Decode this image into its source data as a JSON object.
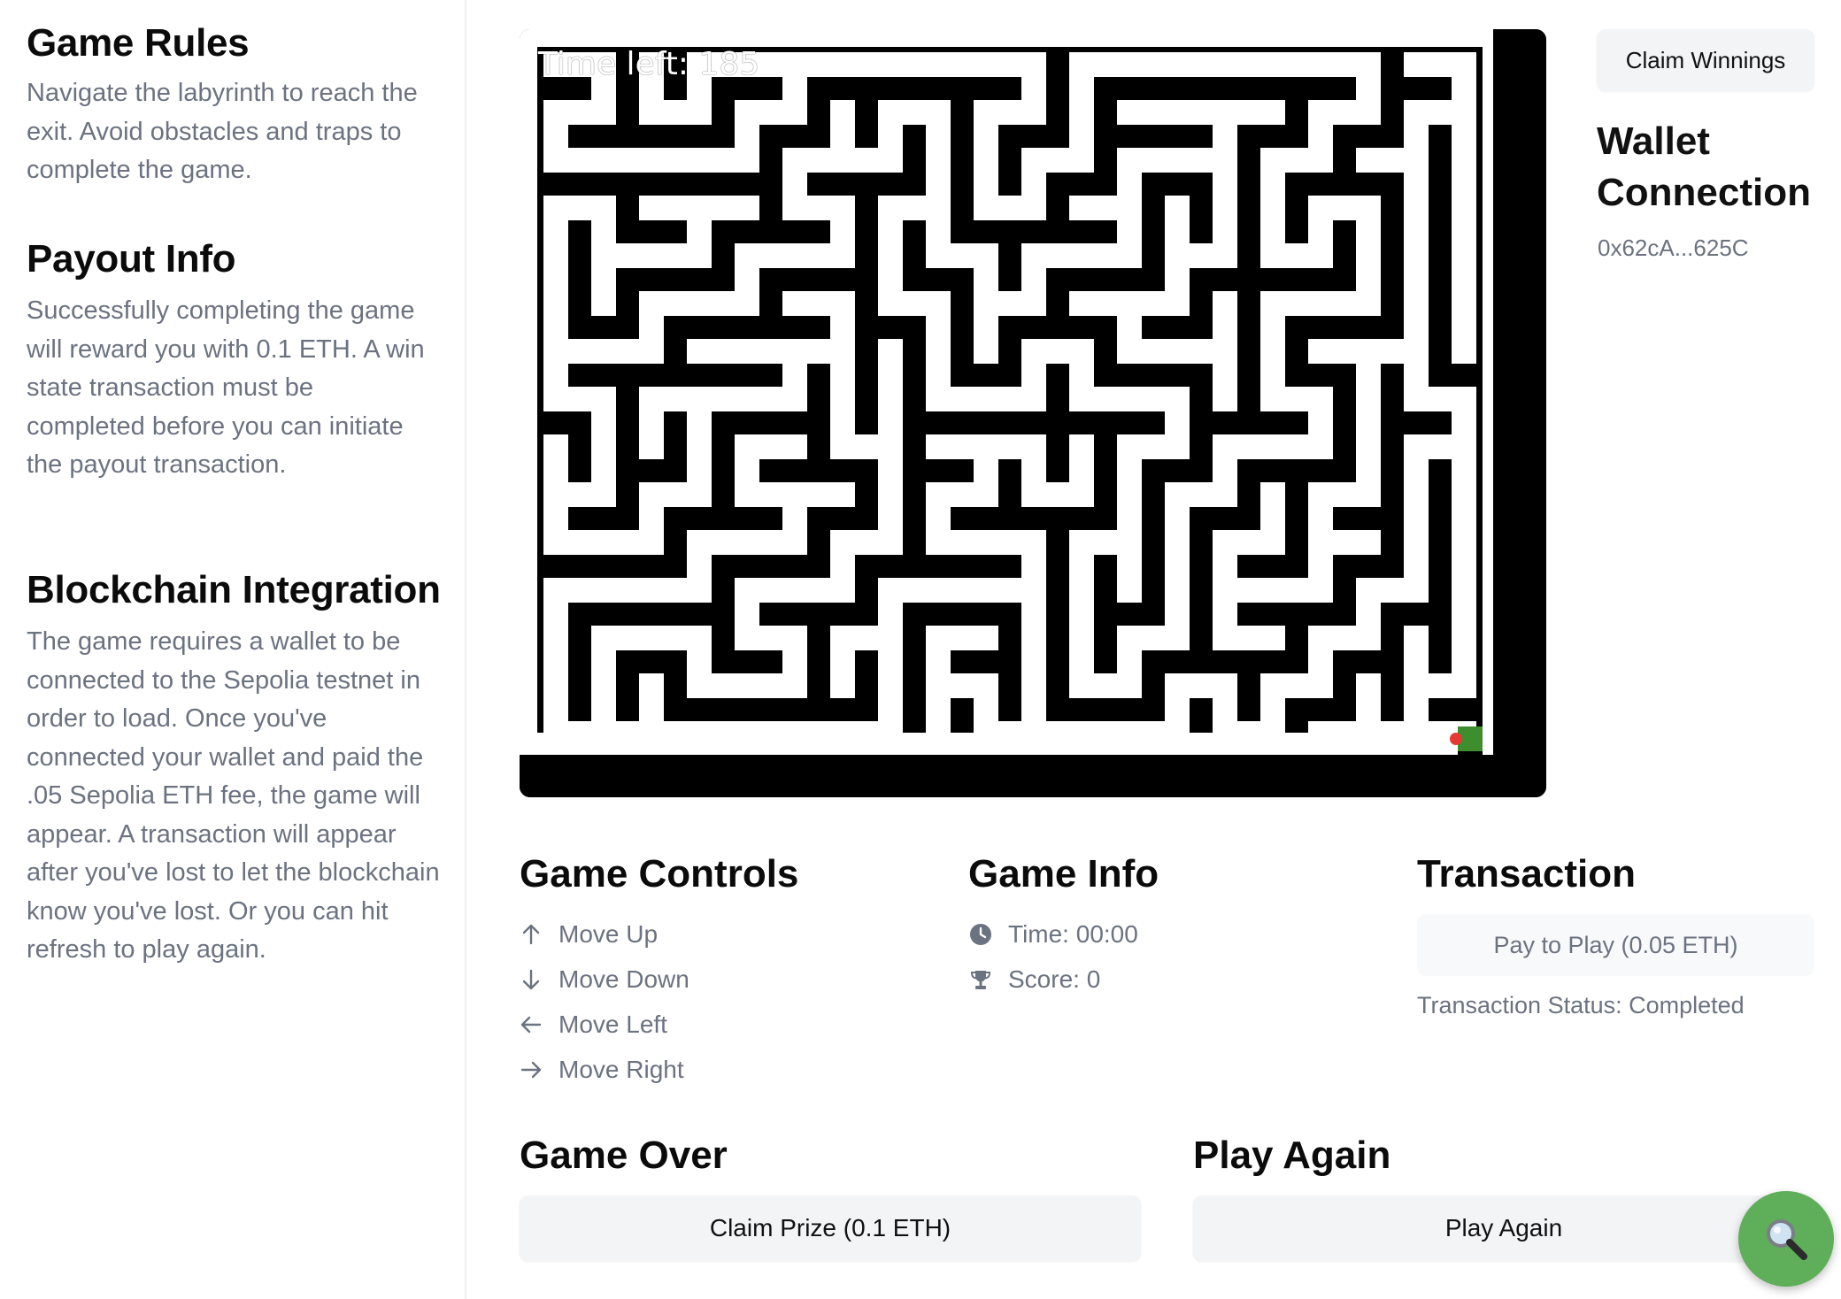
{
  "sidebar": {
    "rules": {
      "title": "Game Rules",
      "text": "Navigate the labyrinth to reach the exit. Avoid obstacles and traps to complete the game."
    },
    "payout": {
      "title": "Payout Info",
      "text": "Successfully completing the game will reward you with 0.1 ETH. A win state transaction must be completed before you can initiate the payout transaction."
    },
    "blockchain": {
      "title": "Blockchain Integration",
      "text": "The game requires a wallet to be connected to the Sepolia testnet in order to load. Once you've connected your wallet and paid the .05 Sepolia ETH fee, the game will appear. A transaction will appear after you've lost to let the blockchain know you've lost. Or you can hit refresh to play again."
    }
  },
  "game": {
    "time_left": "Time left: 185"
  },
  "header": {
    "claim_winnings": "Claim Winnings"
  },
  "wallet": {
    "title": "Wallet Connection",
    "address": "0x62cA...625C"
  },
  "controls": {
    "title": "Game Controls",
    "items": [
      {
        "label": "Move Up",
        "icon": "arrow-up-icon"
      },
      {
        "label": "Move Down",
        "icon": "arrow-down-icon"
      },
      {
        "label": "Move Left",
        "icon": "arrow-left-icon"
      },
      {
        "label": "Move Right",
        "icon": "arrow-right-icon"
      }
    ]
  },
  "info": {
    "title": "Game Info",
    "time": "Time: 00:00",
    "score": "Score: 0"
  },
  "transaction": {
    "title": "Transaction",
    "pay_button": "Pay to Play (0.05 ETH)",
    "status": "Transaction Status: Completed"
  },
  "game_over": {
    "title": "Game Over",
    "button": "Claim Prize (0.1 ETH)"
  },
  "play_again": {
    "title": "Play Again",
    "button": "Play Again"
  },
  "colors": {
    "maze_wall": "#000000",
    "maze_path": "#ffffff",
    "player": "#e53935",
    "exit": "#3e8e2f",
    "fab": "#5fae5a",
    "muted_text": "#6b7280"
  }
}
